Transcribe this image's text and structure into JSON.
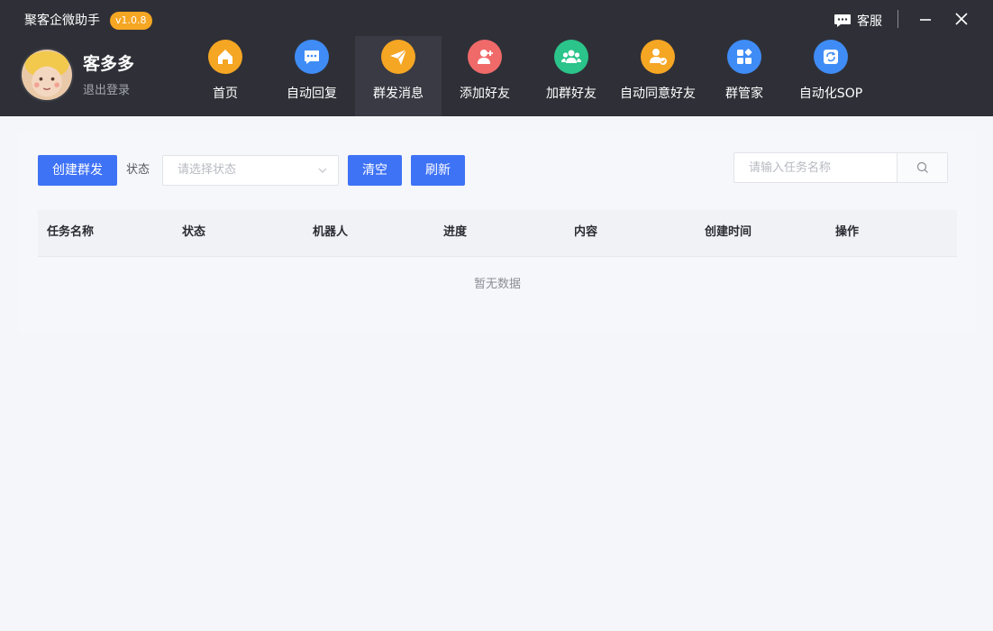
{
  "app": {
    "title": "聚客企微助手",
    "version": "v1.0.8"
  },
  "window_controls": {
    "service_label": "客服"
  },
  "user": {
    "name": "客多多",
    "logout_label": "退出登录"
  },
  "nav": {
    "items": [
      {
        "label": "首页",
        "icon": "home-icon",
        "color": "#f5a623"
      },
      {
        "label": "自动回复",
        "icon": "chat-icon",
        "color": "#3f8cf6"
      },
      {
        "label": "群发消息",
        "icon": "send-icon",
        "color": "#f5a623",
        "active": true
      },
      {
        "label": "添加好友",
        "icon": "add-user-icon",
        "color": "#f06a6a"
      },
      {
        "label": "加群好友",
        "icon": "group-icon",
        "color": "#2bc48a"
      },
      {
        "label": "自动同意好友",
        "icon": "user-check-icon",
        "color": "#f5a623"
      },
      {
        "label": "群管家",
        "icon": "apps-icon",
        "color": "#3f8cf6"
      },
      {
        "label": "自动化SOP",
        "icon": "refresh-icon",
        "color": "#3f8cf6"
      }
    ]
  },
  "toolbar": {
    "create_label": "创建群发",
    "status_label": "状态",
    "status_placeholder": "请选择状态",
    "clear_label": "清空",
    "refresh_label": "刷新",
    "search_placeholder": "请输入任务名称"
  },
  "table": {
    "columns": [
      "任务名称",
      "状态",
      "机器人",
      "进度",
      "内容",
      "创建时间",
      "操作"
    ],
    "empty_text": "暂无数据"
  },
  "colors": {
    "header_bg": "#2f3037",
    "primary": "#3f73f6",
    "badge": "#f5a623"
  }
}
